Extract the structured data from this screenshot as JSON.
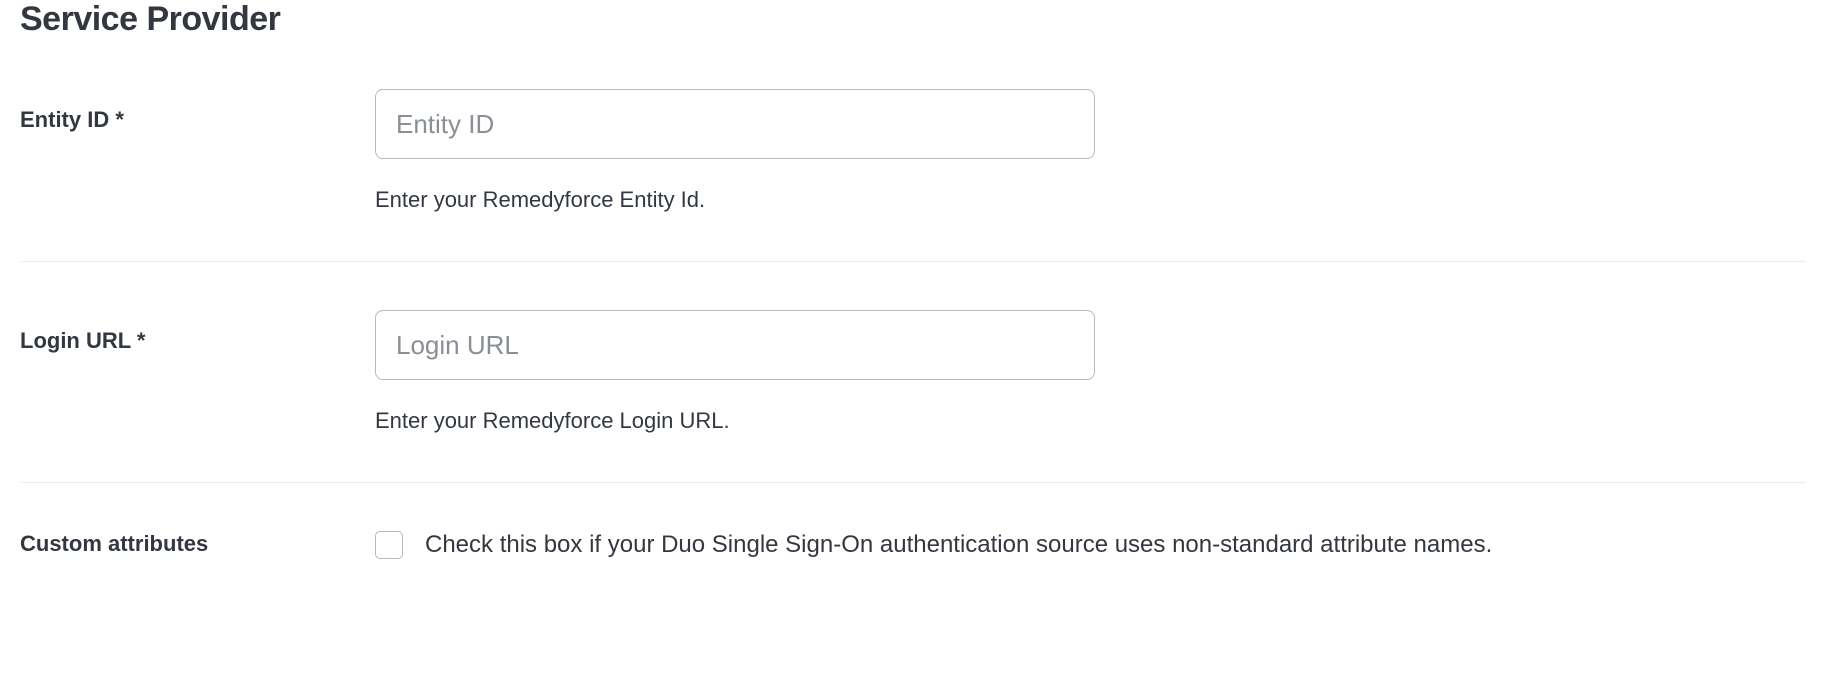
{
  "section": {
    "title": "Service Provider"
  },
  "fields": {
    "entity_id": {
      "label": "Entity ID *",
      "placeholder": "Entity ID",
      "value": "",
      "help": "Enter your Remedyforce Entity Id."
    },
    "login_url": {
      "label": "Login URL *",
      "placeholder": "Login URL",
      "value": "",
      "help": "Enter your Remedyforce Login URL."
    },
    "custom_attributes": {
      "label": "Custom attributes",
      "checkbox_label": "Check this box if your Duo Single Sign-On authentication source uses non-standard attribute names."
    }
  }
}
